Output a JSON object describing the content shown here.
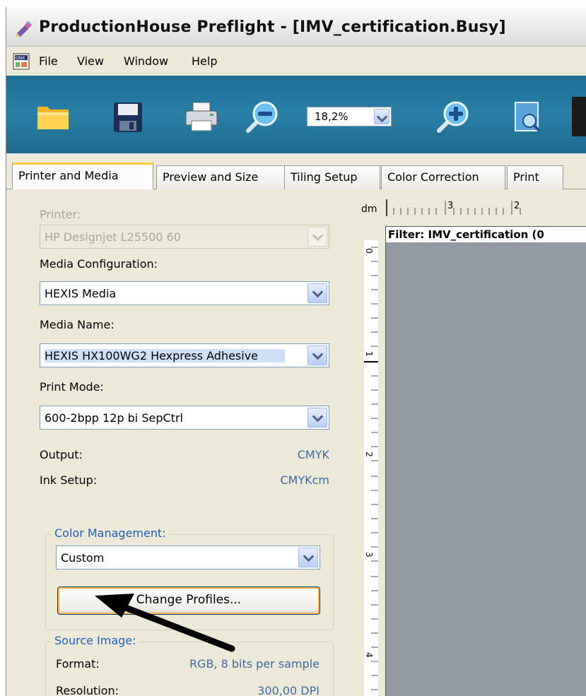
{
  "window": {
    "title": "ProductionHouse Preflight - [IMV_certification.Busy]"
  },
  "menu": {
    "items": [
      "File",
      "View",
      "Window",
      "Help"
    ]
  },
  "toolbar": {
    "zoom_value": "18,2%"
  },
  "tabs": [
    {
      "label": "Printer and Media",
      "active": true
    },
    {
      "label": "Preview and Size",
      "active": false
    },
    {
      "label": "Tiling Setup",
      "active": false
    },
    {
      "label": "Color Correction",
      "active": false
    },
    {
      "label": "Print",
      "active": false
    }
  ],
  "printer_panel": {
    "printer_label": "Printer:",
    "printer_value": "HP Designjet L25500 60",
    "media_config_label": "Media Configuration:",
    "media_config_value": "HEXIS Media",
    "media_name_label": "Media Name:",
    "media_name_value": "HEXIS HX100WG2 Hexpress  Adhesive",
    "print_mode_label": "Print Mode:",
    "print_mode_value": "600-2bpp 12p bi SepCtrl",
    "output_label": "Output:",
    "output_value": "CMYK",
    "ink_setup_label": "Ink Setup:",
    "ink_setup_value": "CMYKcm"
  },
  "color_management": {
    "title": "Color Management:",
    "value": "Custom",
    "change_profiles_label": "Change Profiles..."
  },
  "source_image": {
    "title": "Source Image:",
    "format_label": "Format:",
    "format_value": "RGB, 8 bits per sample",
    "resolution_label": "Resolution:",
    "resolution_value": "300,00 DPI"
  },
  "preview": {
    "ruler_unit": "dm",
    "top_ruler_labels": [
      "3",
      "2"
    ],
    "left_ruler_labels": [
      "0",
      "1",
      "2",
      "3",
      "4"
    ],
    "filter_title": "Filter: IMV_certification (0"
  },
  "colors": {
    "toolbar_blue": "#2a7fa6",
    "canvas_gray": "#949aa4",
    "group_title_blue": "#1f5fb8",
    "value_blue": "#3c6aa5",
    "active_tab_accent": "#ffc83c"
  }
}
